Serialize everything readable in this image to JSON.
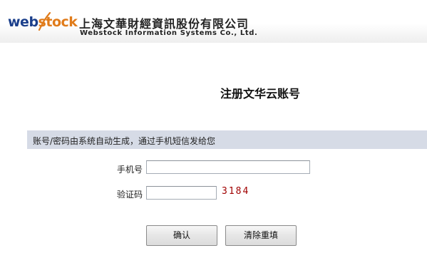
{
  "header": {
    "logo_web": "web",
    "logo_stock": "stock",
    "company_cn": "上海文華財經資訊股份有限公司",
    "company_en": "Webstock Information Systems Co., Ltd.",
    "brand_colors": {
      "web": "#1b3f8b",
      "stock": "#e07b1a"
    }
  },
  "main": {
    "title": "注册文华云账号",
    "notice": "账号/密码由系统自动生成，通过手机短信发给您"
  },
  "form": {
    "phone_label": "手机号",
    "phone_value": "",
    "code_label": "验证码",
    "code_value": "",
    "captcha": "3184"
  },
  "buttons": {
    "confirm": "确认",
    "reset": "清除重填"
  }
}
